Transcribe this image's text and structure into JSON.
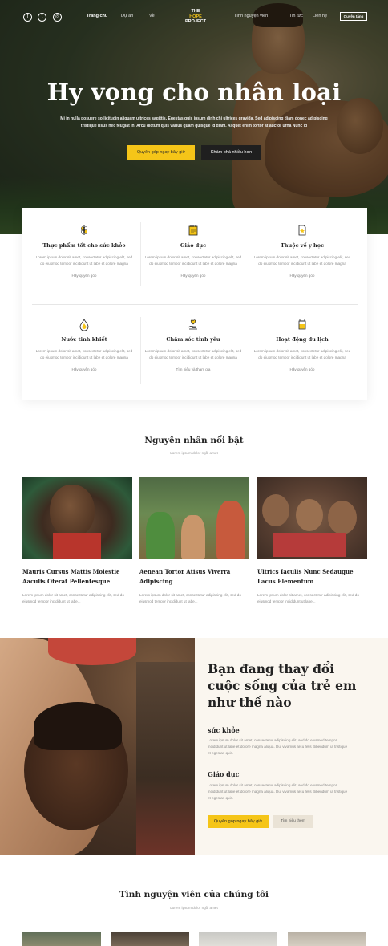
{
  "nav": {
    "social": [
      {
        "icon": "facebook-icon",
        "glyph": "f"
      },
      {
        "icon": "twitter-icon",
        "glyph": "t"
      },
      {
        "icon": "instagram-icon",
        "glyph": "◎"
      }
    ],
    "left_links": [
      "Trang chủ",
      "Dự án",
      "Về"
    ],
    "right_links": [
      "Tình nguyện viên",
      "Tin tức",
      "Liên hệ"
    ],
    "logo": {
      "line1": "THE",
      "line2": "HOPE",
      "line3": "PROJECT"
    },
    "donate_button": "Quyên tặng"
  },
  "hero": {
    "title": "Hy vọng cho nhân loại",
    "subtitle": "Mi in nulla posuere sollicitudin aliquam ultrices sagittis. Egestas quis ipsum dinh chi ultrices gravida. Sed adipiscing diam donec adipiscing tristique risus nec feugiat in. Arcu dictum quis varius quam quisque id diam. Aliquet enim tortor at auctor urna Nunc id",
    "primary_button": "Quyên góp ngay bây giờ",
    "secondary_button": "Khám phá nhiều hơn"
  },
  "services": [
    {
      "icon": "wheat-icon",
      "title": "Thực phẩm tốt cho sức khỏe",
      "text": "Lorem ipsum dolor sit amet, consectetur adipiscing elit, sed do eiusmod tempor incididunt ut labe et dolore magna",
      "link": "Hãy quyên góp"
    },
    {
      "icon": "notepad-icon",
      "title": "Giáo dục",
      "text": "Lorem ipsum dolor sit amet, consectetur adipiscing elit, sed do eiusmod tempor incididunt ut labe et dolore magna",
      "link": "Hãy quyên góp"
    },
    {
      "icon": "document-icon",
      "title": "Thuộc về y học",
      "text": "Lorem ipsum dolor sit amet, consectetur adipiscing elit, sed do eiusmod tempor incididunt ut labe et dolore magna",
      "link": "Hãy quyên góp"
    },
    {
      "icon": "water-drop-icon",
      "title": "Nước tinh khiết",
      "text": "Lorem ipsum dolor sit amet, consectetur adipiscing elit, sed do eiusmod tempor incididunt ut labe et dolore magna",
      "link": "Hãy quyên góp"
    },
    {
      "icon": "heart-hand-icon",
      "title": "Chăm sóc tình yêu",
      "text": "Lorem ipsum dolor sit amet, consectetur adipiscing elit, sed do eiusmod tempor incididunt ut labe et dolore magna",
      "link": "Tìm hiểu và tham gia"
    },
    {
      "icon": "jar-icon",
      "title": "Hoạt động du lịch",
      "text": "Lorem ipsum dolor sit amet, consectetur adipiscing elit, sed do eiusmod tempor incididunt ut labe et dolore magna",
      "link": "Hãy quyên góp"
    }
  ],
  "causes": {
    "title": "Nguyên nhân nổi bật",
    "subtitle": "Lorem ipsum dolor ngồi amet",
    "items": [
      {
        "title": "Mauris Cursus Mattis Molestie Aaculis Oterat Pellentesque",
        "text": "Lorem ipsum dolor sit amet, consectetur adipiscing elit, sed do eiusmod tempor incididunt ut labe..."
      },
      {
        "title": "Aenean Tortor Atisus Viverra Adipiscing",
        "text": "Lorem ipsum dolor sit amet, consectetur adipiscing elit, sed do eiusmod tempor incididunt ut labe..."
      },
      {
        "title": "Ultrics Iaculis Nunc Sedaugue Lacus Elementum",
        "text": "Lorem ipsum dolor sit amet, consectetur adipiscing elit, sed do eiusmod tempor incididunt ut labe..."
      }
    ]
  },
  "change": {
    "title": "Bạn đang thay đổi cuộc sống của trẻ em như thế nào",
    "health_title": "sức khỏe",
    "health_text": "Lorem ipsum dolor sit amet, consectetur adipiscing elit, sed do eiusmod tempor incididunt ut labe et dolore magna aliqua. Dui vivamus arcu felis Bibendum ut tristique et egestas quis.",
    "edu_title": "Giáo dục",
    "edu_text": "Lorem ipsum dolor sit amet, consectetur adipiscing elit, sed do eiusmod tempor incididunt ut labe et dolore magna aliqua. Dui vivamus arcu felis Bibendum ut tristique et egestas quis.",
    "primary_button": "Quyên góp ngay bây giờ",
    "secondary_button": "Tìm hiểu thêm"
  },
  "volunteers": {
    "title": "Tình nguyện viên của chúng tôi",
    "subtitle": "Lorem ipsum dolor ngồi amet"
  },
  "colors": {
    "accent": "#f5c518",
    "dark": "#1f1f1f",
    "cream": "#faf6ef"
  }
}
